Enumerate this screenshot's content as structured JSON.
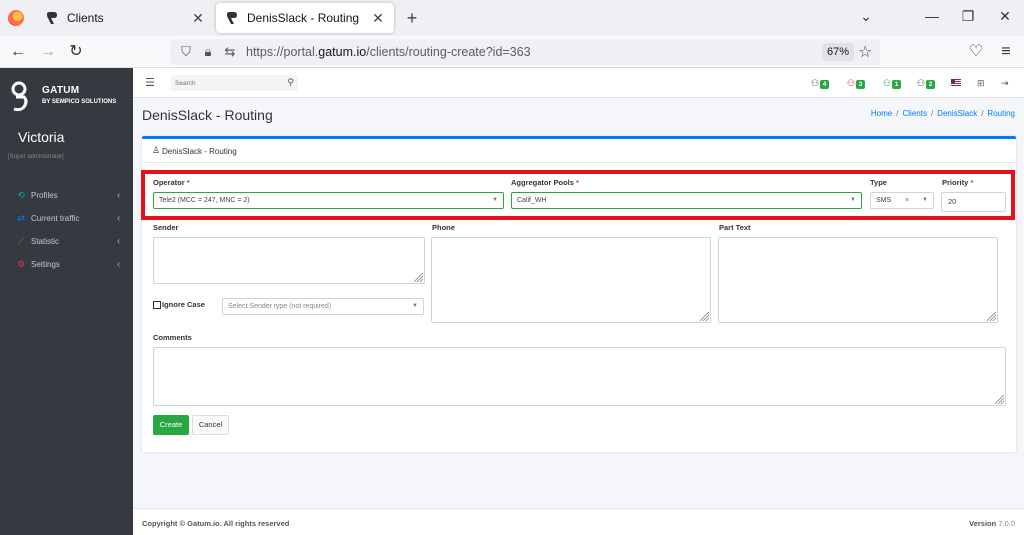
{
  "browser": {
    "tabs": [
      {
        "title": "Clients",
        "active": false
      },
      {
        "title": "DenisSlack - Routing",
        "active": true
      }
    ],
    "url_prefix": "https://portal.",
    "url_domain": "gatum.io",
    "url_path": "/clients/routing-create?id=363",
    "zoom": "67%"
  },
  "sidebar": {
    "brand_name": "GATUM",
    "brand_sub": "BY SEMPICO SOLUTIONS",
    "user_name": "Victoria",
    "user_role": "[Super administrator]",
    "menu": [
      {
        "label": "Profiles",
        "icon": "⟲"
      },
      {
        "label": "Current traffic",
        "icon": "⇄"
      },
      {
        "label": "Statistic",
        "icon": "⟋"
      },
      {
        "label": "Settings",
        "icon": "⚙"
      }
    ]
  },
  "appbar": {
    "search_placeholder": "Search",
    "badges": [
      {
        "value": "4",
        "color": "#28a745"
      },
      {
        "value": "3",
        "color": "#28a745"
      },
      {
        "value": "1",
        "color": "#28a745"
      },
      {
        "value": "2",
        "color": "#28a745"
      }
    ]
  },
  "page": {
    "title": "DenisSlack - Routing",
    "breadcrumb": [
      "Home",
      "Clients",
      "DenisSlack",
      "Routing"
    ]
  },
  "form": {
    "card_title": "DenisSlack - Routing",
    "operator_label": "Operator",
    "operator_value": "Tele2 (MCC = 247, MNC = 2)",
    "pools_label": "Aggregator Pools",
    "pools_value": "Calif_WH",
    "type_label": "Type",
    "type_value": "SMS",
    "type_clear": "×",
    "priority_label": "Priority",
    "priority_value": "20",
    "required_mark": "*",
    "sender_label": "Sender",
    "phone_label": "Phone",
    "part_text_label": "Part Text",
    "ignore_case_label": "Ignore Case",
    "sender_type_placeholder": "Select Sender type (not required)",
    "comments_label": "Comments",
    "create_label": "Create",
    "cancel_label": "Cancel"
  },
  "footer": {
    "copyright": "Copyright © Gatum.io. All rights reserved",
    "version_label": "Version",
    "version_value": "7.0.0"
  },
  "colors": {
    "highlight": "#e3101e",
    "primary": "#007bff",
    "success": "#28a745",
    "sidebar_bg": "#343a40"
  }
}
